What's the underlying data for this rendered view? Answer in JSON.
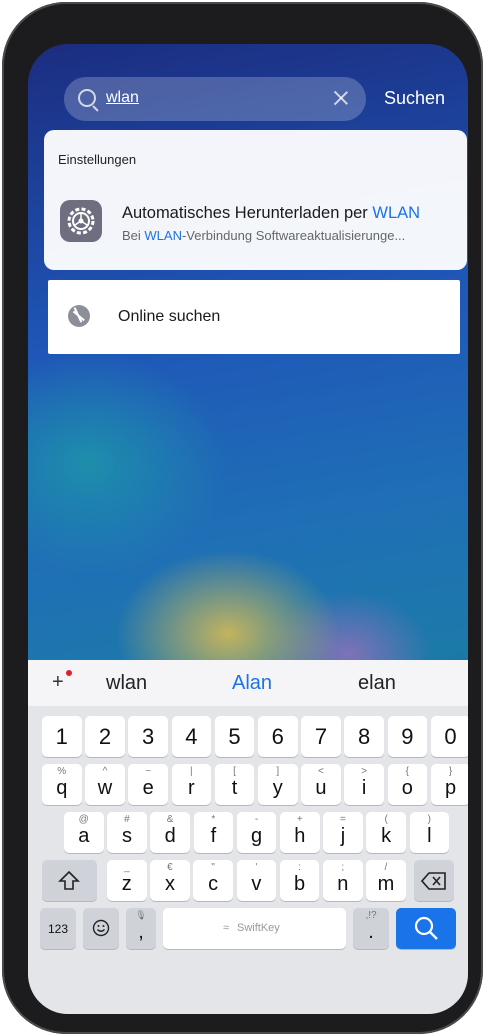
{
  "search": {
    "query": "wlan",
    "button": "Suchen"
  },
  "results": {
    "section": "Einstellungen",
    "title_prefix": "Automatisches Herunterladen per ",
    "title_highlight": "WLAN",
    "sub_prefix": "Bei ",
    "sub_highlight": "WLAN",
    "sub_rest": "-Verbindung Softwareaktualisierunge..."
  },
  "online": {
    "label": "Online suchen"
  },
  "keyboard": {
    "suggestions": [
      "wlan",
      "Alan",
      "elan"
    ],
    "numbers": [
      "1",
      "2",
      "3",
      "4",
      "5",
      "6",
      "7",
      "8",
      "9",
      "0"
    ],
    "row1": [
      {
        "m": "q",
        "s": "%"
      },
      {
        "m": "w",
        "s": "^"
      },
      {
        "m": "e",
        "s": "~"
      },
      {
        "m": "r",
        "s": "|"
      },
      {
        "m": "t",
        "s": "["
      },
      {
        "m": "y",
        "s": "]"
      },
      {
        "m": "u",
        "s": "<"
      },
      {
        "m": "i",
        "s": ">"
      },
      {
        "m": "o",
        "s": "{"
      },
      {
        "m": "p",
        "s": "}"
      }
    ],
    "row2": [
      {
        "m": "a",
        "s": "@"
      },
      {
        "m": "s",
        "s": "#"
      },
      {
        "m": "d",
        "s": "&"
      },
      {
        "m": "f",
        "s": "*"
      },
      {
        "m": "g",
        "s": "-"
      },
      {
        "m": "h",
        "s": "+"
      },
      {
        "m": "j",
        "s": "="
      },
      {
        "m": "k",
        "s": "("
      },
      {
        "m": "l",
        "s": ")"
      }
    ],
    "row3": [
      {
        "m": "z",
        "s": "_"
      },
      {
        "m": "x",
        "s": "€"
      },
      {
        "m": "c",
        "s": "\""
      },
      {
        "m": "v",
        "s": "'"
      },
      {
        "m": "b",
        "s": ":"
      },
      {
        "m": "n",
        "s": ";"
      },
      {
        "m": "m",
        "s": "/"
      }
    ],
    "mode_key": "123",
    "comma": ",",
    "space_label": "SwiftKey",
    "period": ".",
    "period_alt": ",!?"
  }
}
